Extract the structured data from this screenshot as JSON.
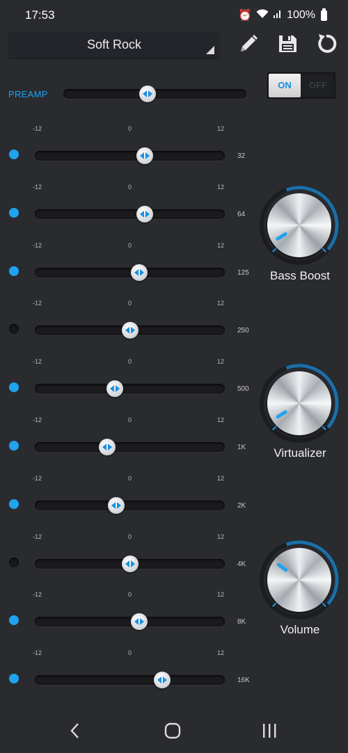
{
  "status": {
    "time": "17:53",
    "battery": "100%"
  },
  "preset": {
    "name": "Soft Rock"
  },
  "toolbar": {
    "edit_icon": "pencil-icon",
    "save_icon": "save-icon",
    "reset_icon": "reset-icon"
  },
  "preamp": {
    "label": "PREAMP",
    "level_fraction": 0.46
  },
  "power": {
    "on": "ON",
    "off": "OFF",
    "state": "on"
  },
  "scale": {
    "min": "-12",
    "mid": "0",
    "max": "12"
  },
  "bands": [
    {
      "freq": "32",
      "enabled": true,
      "level_fraction": 0.58
    },
    {
      "freq": "64",
      "enabled": true,
      "level_fraction": 0.58
    },
    {
      "freq": "125",
      "enabled": true,
      "level_fraction": 0.55
    },
    {
      "freq": "250",
      "enabled": false,
      "level_fraction": 0.5
    },
    {
      "freq": "500",
      "enabled": true,
      "level_fraction": 0.42
    },
    {
      "freq": "1K",
      "enabled": true,
      "level_fraction": 0.38
    },
    {
      "freq": "2K",
      "enabled": true,
      "level_fraction": 0.43
    },
    {
      "freq": "4K",
      "enabled": false,
      "level_fraction": 0.5
    },
    {
      "freq": "8K",
      "enabled": true,
      "level_fraction": 0.55
    },
    {
      "freq": "16K",
      "enabled": true,
      "level_fraction": 0.67
    }
  ],
  "knobs": [
    {
      "label": "Bass Boost",
      "level_fraction": 0.05
    },
    {
      "label": "Virtualizer",
      "level_fraction": 0.05
    },
    {
      "label": "Volume",
      "level_fraction": 0.3
    }
  ],
  "colors": {
    "accent": "#1fa3ef",
    "background": "#2a2b2f"
  },
  "navigation": {
    "back_icon": "back-icon",
    "home_icon": "home-icon",
    "recents_icon": "recents-icon"
  }
}
